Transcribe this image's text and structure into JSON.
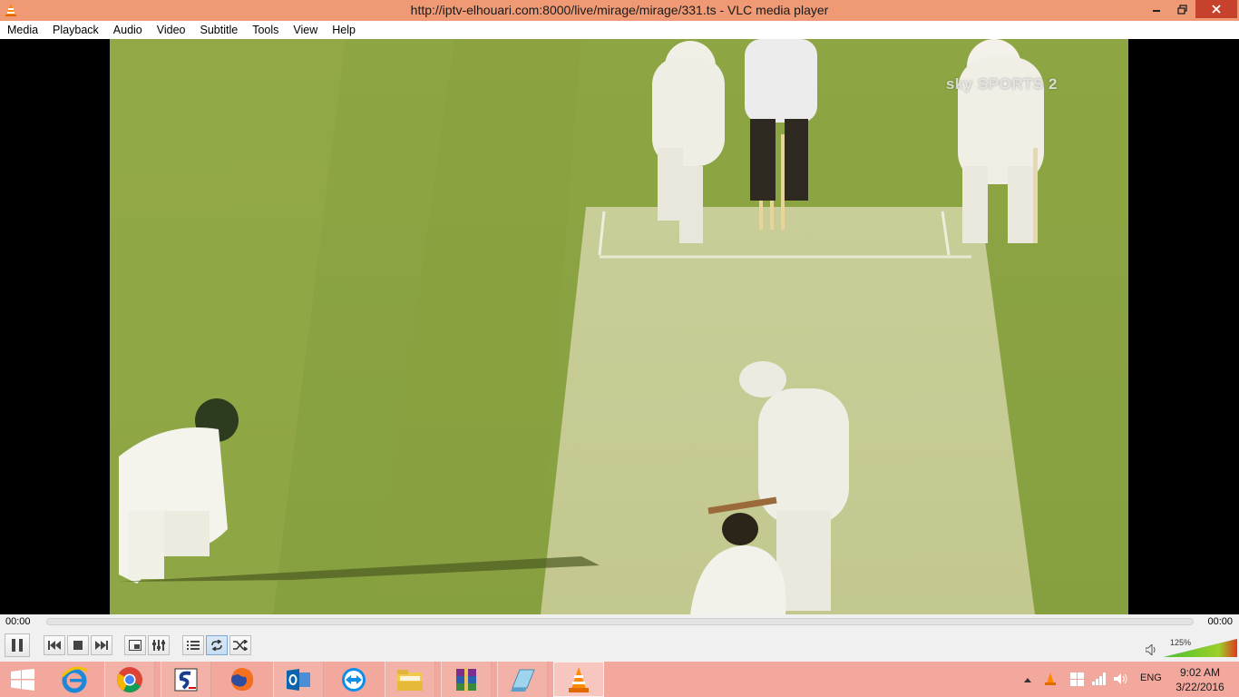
{
  "window": {
    "title": "http://iptv-elhouari.com:8000/live/mirage/mirage/331.ts - VLC media player"
  },
  "menu": [
    "Media",
    "Playback",
    "Audio",
    "Video",
    "Subtitle",
    "Tools",
    "View",
    "Help"
  ],
  "video": {
    "channel_logo": "sky SPORTS 2"
  },
  "playback": {
    "elapsed": "00:00",
    "total": "00:00",
    "position_fraction": 0,
    "volume_label": "125%",
    "volume_fraction": 1.0
  },
  "controls": {
    "buttons": [
      "pause-icon",
      "previous-icon",
      "stop-icon",
      "next-icon",
      "fullscreen-icon",
      "extended-settings-icon",
      "playlist-icon",
      "loop-icon",
      "shuffle-icon"
    ]
  },
  "taskbar": {
    "apps": [
      "internet-explorer-icon",
      "chrome-icon",
      "app-s-icon",
      "firefox-icon",
      "outlook-icon",
      "teamviewer-icon",
      "file-explorer-icon",
      "winrar-icon",
      "notepad-icon",
      "vlc-icon"
    ],
    "language": "ENG",
    "time": "9:02 AM",
    "date": "3/22/2016"
  },
  "colors": {
    "titlebar": "#ef9a75",
    "close": "#c7422d",
    "taskbar": "#f2a89d",
    "pitch_green": "#8faa45",
    "vlc_orange": "#ff8800"
  }
}
